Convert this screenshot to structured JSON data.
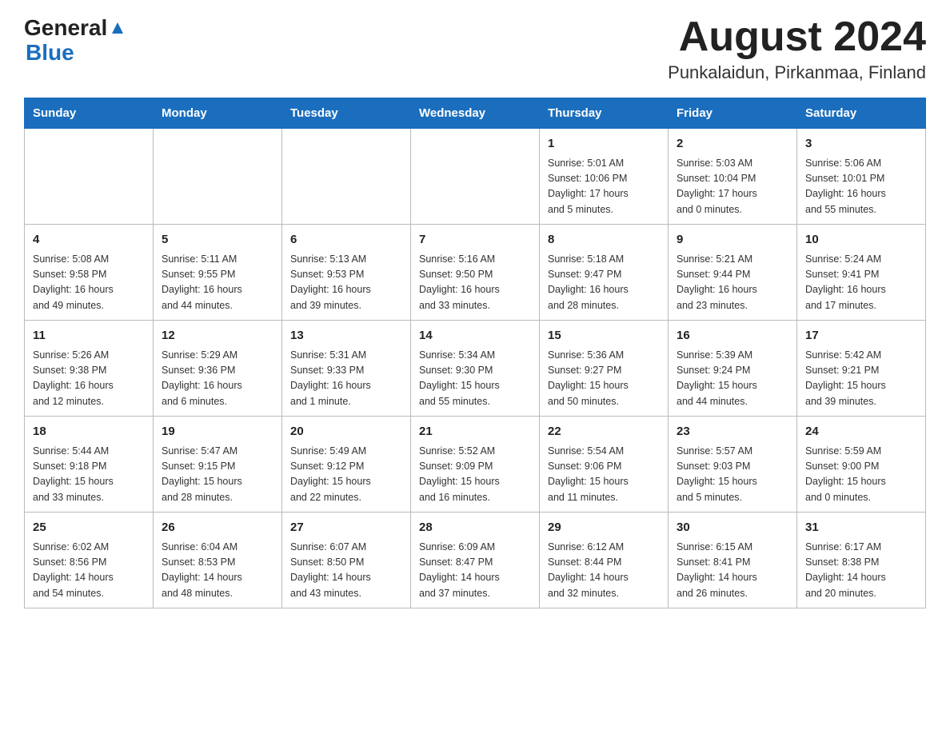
{
  "header": {
    "logo_general": "General",
    "logo_blue": "Blue",
    "month_title": "August 2024",
    "subtitle": "Punkalaidun, Pirkanmaa, Finland"
  },
  "calendar": {
    "days_of_week": [
      "Sunday",
      "Monday",
      "Tuesday",
      "Wednesday",
      "Thursday",
      "Friday",
      "Saturday"
    ],
    "weeks": [
      [
        {
          "day": "",
          "info": ""
        },
        {
          "day": "",
          "info": ""
        },
        {
          "day": "",
          "info": ""
        },
        {
          "day": "",
          "info": ""
        },
        {
          "day": "1",
          "info": "Sunrise: 5:01 AM\nSunset: 10:06 PM\nDaylight: 17 hours\nand 5 minutes."
        },
        {
          "day": "2",
          "info": "Sunrise: 5:03 AM\nSunset: 10:04 PM\nDaylight: 17 hours\nand 0 minutes."
        },
        {
          "day": "3",
          "info": "Sunrise: 5:06 AM\nSunset: 10:01 PM\nDaylight: 16 hours\nand 55 minutes."
        }
      ],
      [
        {
          "day": "4",
          "info": "Sunrise: 5:08 AM\nSunset: 9:58 PM\nDaylight: 16 hours\nand 49 minutes."
        },
        {
          "day": "5",
          "info": "Sunrise: 5:11 AM\nSunset: 9:55 PM\nDaylight: 16 hours\nand 44 minutes."
        },
        {
          "day": "6",
          "info": "Sunrise: 5:13 AM\nSunset: 9:53 PM\nDaylight: 16 hours\nand 39 minutes."
        },
        {
          "day": "7",
          "info": "Sunrise: 5:16 AM\nSunset: 9:50 PM\nDaylight: 16 hours\nand 33 minutes."
        },
        {
          "day": "8",
          "info": "Sunrise: 5:18 AM\nSunset: 9:47 PM\nDaylight: 16 hours\nand 28 minutes."
        },
        {
          "day": "9",
          "info": "Sunrise: 5:21 AM\nSunset: 9:44 PM\nDaylight: 16 hours\nand 23 minutes."
        },
        {
          "day": "10",
          "info": "Sunrise: 5:24 AM\nSunset: 9:41 PM\nDaylight: 16 hours\nand 17 minutes."
        }
      ],
      [
        {
          "day": "11",
          "info": "Sunrise: 5:26 AM\nSunset: 9:38 PM\nDaylight: 16 hours\nand 12 minutes."
        },
        {
          "day": "12",
          "info": "Sunrise: 5:29 AM\nSunset: 9:36 PM\nDaylight: 16 hours\nand 6 minutes."
        },
        {
          "day": "13",
          "info": "Sunrise: 5:31 AM\nSunset: 9:33 PM\nDaylight: 16 hours\nand 1 minute."
        },
        {
          "day": "14",
          "info": "Sunrise: 5:34 AM\nSunset: 9:30 PM\nDaylight: 15 hours\nand 55 minutes."
        },
        {
          "day": "15",
          "info": "Sunrise: 5:36 AM\nSunset: 9:27 PM\nDaylight: 15 hours\nand 50 minutes."
        },
        {
          "day": "16",
          "info": "Sunrise: 5:39 AM\nSunset: 9:24 PM\nDaylight: 15 hours\nand 44 minutes."
        },
        {
          "day": "17",
          "info": "Sunrise: 5:42 AM\nSunset: 9:21 PM\nDaylight: 15 hours\nand 39 minutes."
        }
      ],
      [
        {
          "day": "18",
          "info": "Sunrise: 5:44 AM\nSunset: 9:18 PM\nDaylight: 15 hours\nand 33 minutes."
        },
        {
          "day": "19",
          "info": "Sunrise: 5:47 AM\nSunset: 9:15 PM\nDaylight: 15 hours\nand 28 minutes."
        },
        {
          "day": "20",
          "info": "Sunrise: 5:49 AM\nSunset: 9:12 PM\nDaylight: 15 hours\nand 22 minutes."
        },
        {
          "day": "21",
          "info": "Sunrise: 5:52 AM\nSunset: 9:09 PM\nDaylight: 15 hours\nand 16 minutes."
        },
        {
          "day": "22",
          "info": "Sunrise: 5:54 AM\nSunset: 9:06 PM\nDaylight: 15 hours\nand 11 minutes."
        },
        {
          "day": "23",
          "info": "Sunrise: 5:57 AM\nSunset: 9:03 PM\nDaylight: 15 hours\nand 5 minutes."
        },
        {
          "day": "24",
          "info": "Sunrise: 5:59 AM\nSunset: 9:00 PM\nDaylight: 15 hours\nand 0 minutes."
        }
      ],
      [
        {
          "day": "25",
          "info": "Sunrise: 6:02 AM\nSunset: 8:56 PM\nDaylight: 14 hours\nand 54 minutes."
        },
        {
          "day": "26",
          "info": "Sunrise: 6:04 AM\nSunset: 8:53 PM\nDaylight: 14 hours\nand 48 minutes."
        },
        {
          "day": "27",
          "info": "Sunrise: 6:07 AM\nSunset: 8:50 PM\nDaylight: 14 hours\nand 43 minutes."
        },
        {
          "day": "28",
          "info": "Sunrise: 6:09 AM\nSunset: 8:47 PM\nDaylight: 14 hours\nand 37 minutes."
        },
        {
          "day": "29",
          "info": "Sunrise: 6:12 AM\nSunset: 8:44 PM\nDaylight: 14 hours\nand 32 minutes."
        },
        {
          "day": "30",
          "info": "Sunrise: 6:15 AM\nSunset: 8:41 PM\nDaylight: 14 hours\nand 26 minutes."
        },
        {
          "day": "31",
          "info": "Sunrise: 6:17 AM\nSunset: 8:38 PM\nDaylight: 14 hours\nand 20 minutes."
        }
      ]
    ]
  }
}
